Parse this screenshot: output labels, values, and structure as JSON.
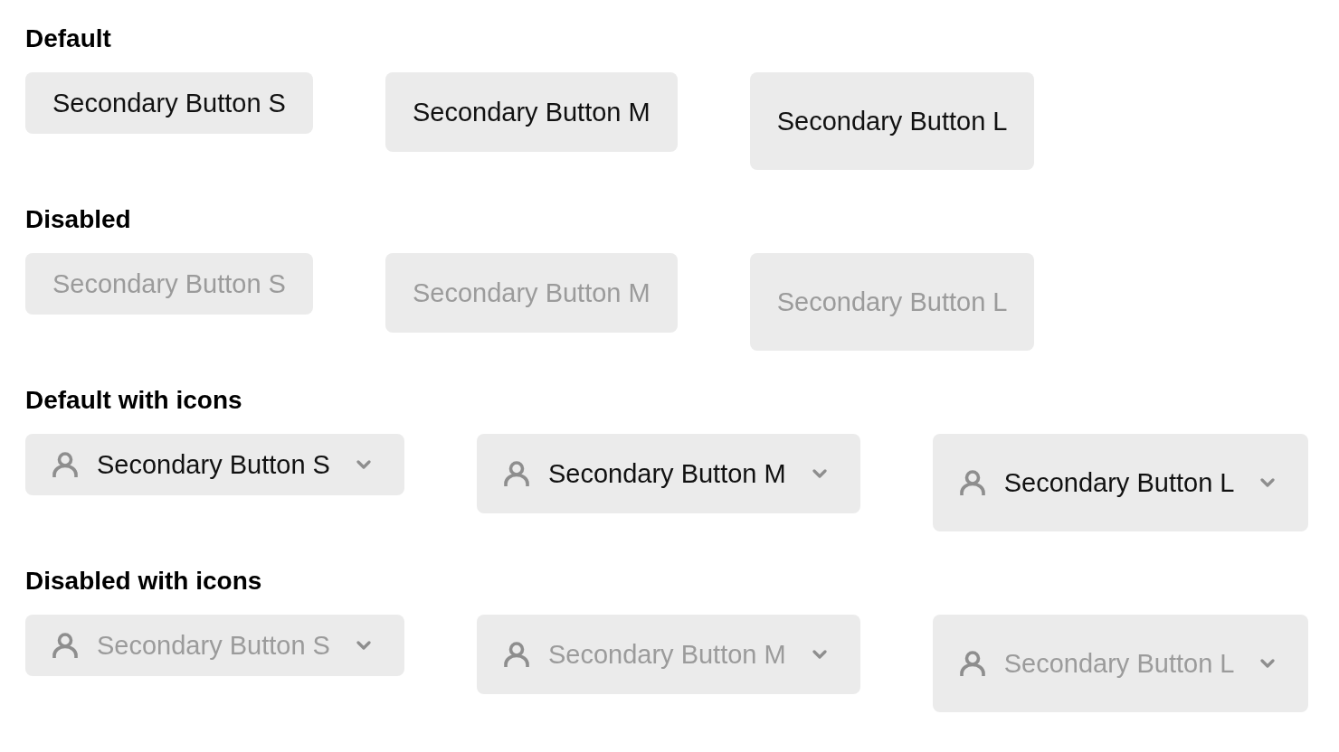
{
  "sections": [
    {
      "title": "Default",
      "buttons": [
        {
          "label": "Secondary Button S",
          "kind": "plain",
          "disabled": false
        },
        {
          "label": "Secondary Button M",
          "kind": "plain",
          "disabled": false
        },
        {
          "label": "Secondary Button L",
          "kind": "plain",
          "disabled": false
        }
      ]
    },
    {
      "title": "Disabled",
      "buttons": [
        {
          "label": "Secondary Button S",
          "kind": "plain",
          "disabled": true
        },
        {
          "label": "Secondary Button M",
          "kind": "plain",
          "disabled": true
        },
        {
          "label": "Secondary Button L",
          "kind": "plain",
          "disabled": true
        }
      ]
    },
    {
      "title": "Default with icons",
      "buttons": [
        {
          "label": "Secondary Button S",
          "kind": "icons",
          "disabled": false
        },
        {
          "label": "Secondary Button M",
          "kind": "icons",
          "disabled": false
        },
        {
          "label": "Secondary Button L",
          "kind": "icons",
          "disabled": false
        }
      ]
    },
    {
      "title": "Disabled with icons",
      "buttons": [
        {
          "label": "Secondary Button S",
          "kind": "icons",
          "disabled": true
        },
        {
          "label": "Secondary Button M",
          "kind": "icons",
          "disabled": true
        },
        {
          "label": "Secondary Button L",
          "kind": "icons",
          "disabled": true
        }
      ]
    }
  ]
}
